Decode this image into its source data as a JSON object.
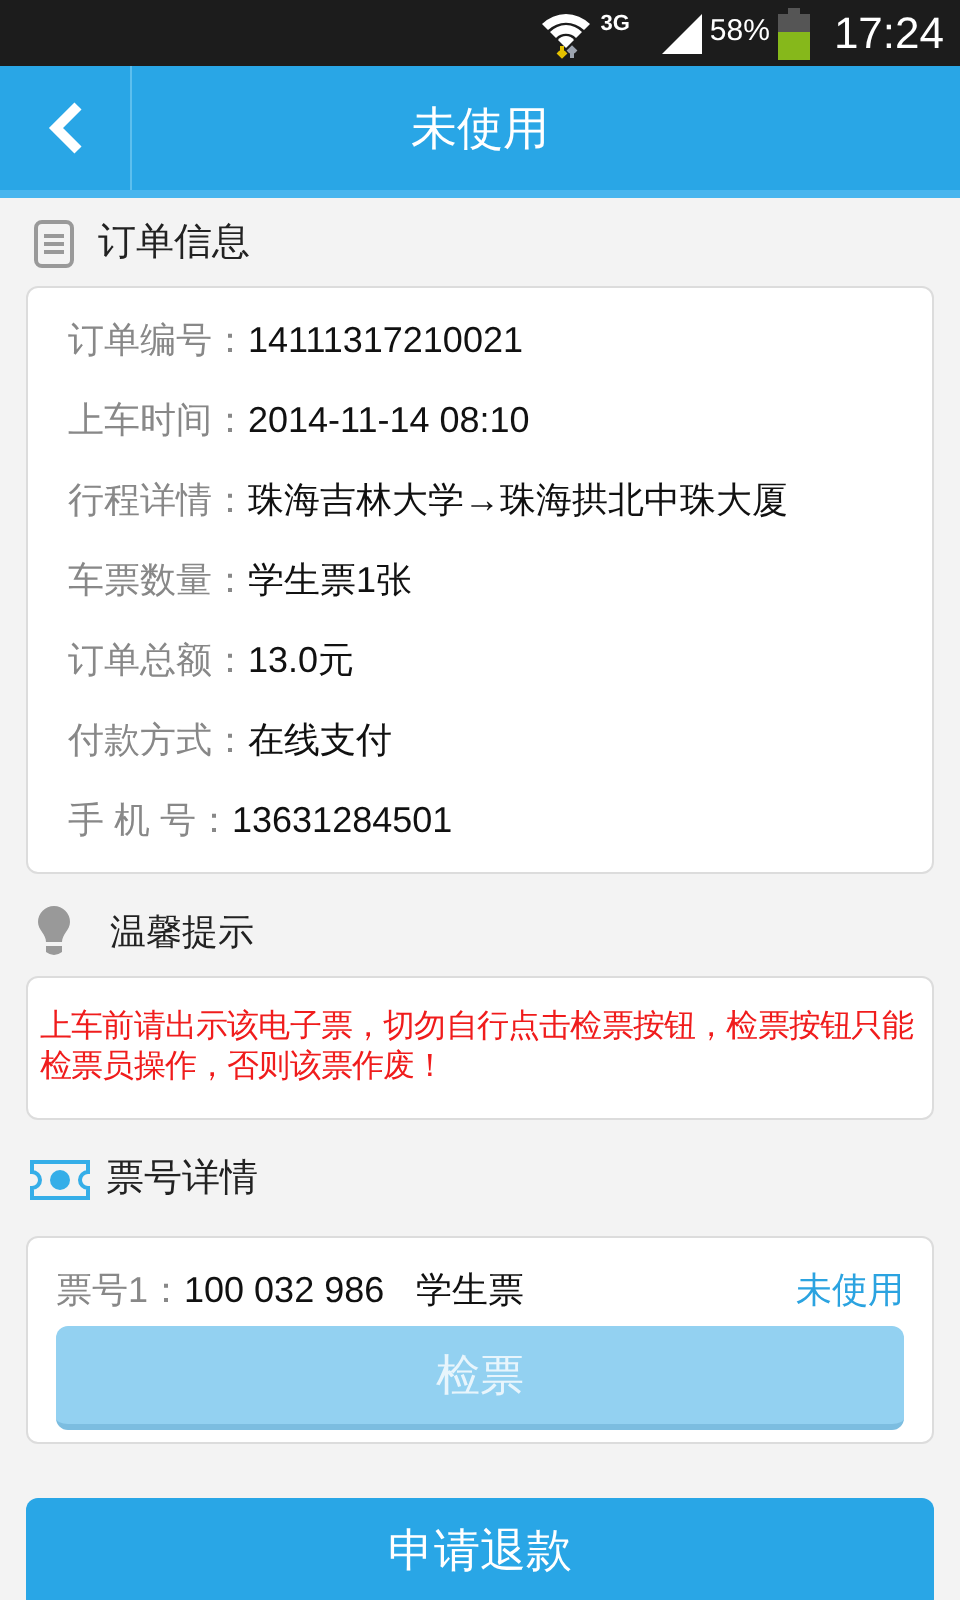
{
  "status_bar": {
    "network": "3G",
    "battery_percent": "58%",
    "time": "17:24"
  },
  "header": {
    "title": "未使用"
  },
  "order_section": {
    "title": "订单信息",
    "rows": [
      {
        "label": "订单编号：",
        "value": "14111317210021"
      },
      {
        "label": "上车时间：",
        "value": "2014-11-14 08:10"
      },
      {
        "label": "行程详情：",
        "value": "珠海吉林大学→珠海拱北中珠大厦"
      },
      {
        "label": "车票数量：",
        "value": "学生票1张"
      },
      {
        "label": "订单总额：",
        "value": "13.0元"
      },
      {
        "label": "付款方式：",
        "value": "在线支付"
      },
      {
        "label": "手 机 号：",
        "value": "13631284501"
      }
    ]
  },
  "tip_section": {
    "title": "温馨提示",
    "text": "上车前请出示该电子票，切勿自行点击检票按钮，检票按钮只能检票员操作，否则该票作废！"
  },
  "ticket_section": {
    "title": "票号详情",
    "tickets": [
      {
        "label": "票号1：",
        "number": "100 032 986",
        "type": "学生票",
        "status": "未使用",
        "check_button": {
          "label": "检票",
          "disabled": true
        }
      }
    ]
  },
  "refund_button": {
    "label": "申请退款"
  }
}
